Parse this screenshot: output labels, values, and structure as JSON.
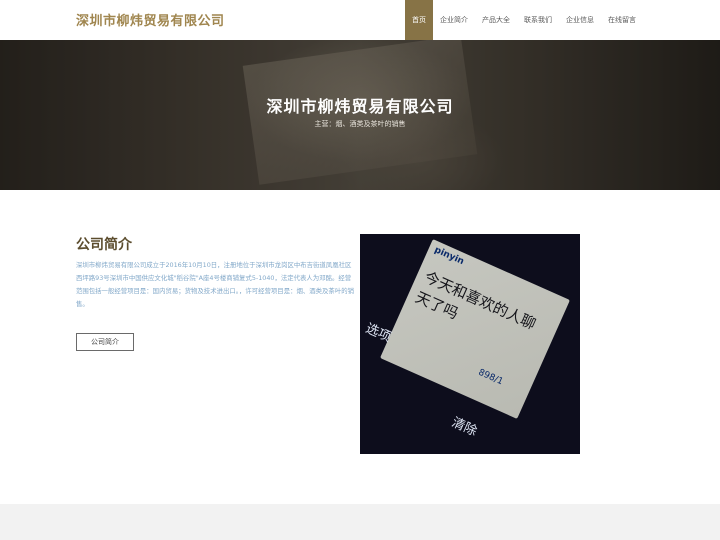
{
  "header": {
    "site_title": "深圳市柳炜贸易有限公司",
    "nav": [
      {
        "label": "首页",
        "active": true
      },
      {
        "label": "企业简介",
        "active": false
      },
      {
        "label": "产品大全",
        "active": false
      },
      {
        "label": "联系我们",
        "active": false
      },
      {
        "label": "企业信息",
        "active": false
      },
      {
        "label": "在线留言",
        "active": false
      }
    ]
  },
  "banner": {
    "title": "深圳市柳炜贸易有限公司",
    "subtitle": "主营：烟、酒类及茶叶的销售"
  },
  "intro": {
    "heading": "公司简介",
    "text": "深圳市柳炜贸易有限公司成立于2016年10月10日，注册地位于深圳市龙岗区中布吉街道凤凰社区西坪路93号深圳市中国供应文化城\"稻谷院\"A座4号楼商铺复式5-1040，法定代表人为邓酩。经营范围包括一般经营项目是：国内贸易；货物及技术进出口。，许可经营项目是：烟、酒类及茶叶的销售。",
    "button_label": "公司简介"
  },
  "photo": {
    "screen_top": "pinyin",
    "screen_lines": [
      "今天和喜欢的人聊",
      "天了吗"
    ],
    "counter": "898/1",
    "left_soft_key": "选项",
    "right_soft_key": "清除"
  },
  "colors": {
    "brand": "#a0864f",
    "nav_active": "#877346",
    "intro_text": "#82a8c9"
  }
}
